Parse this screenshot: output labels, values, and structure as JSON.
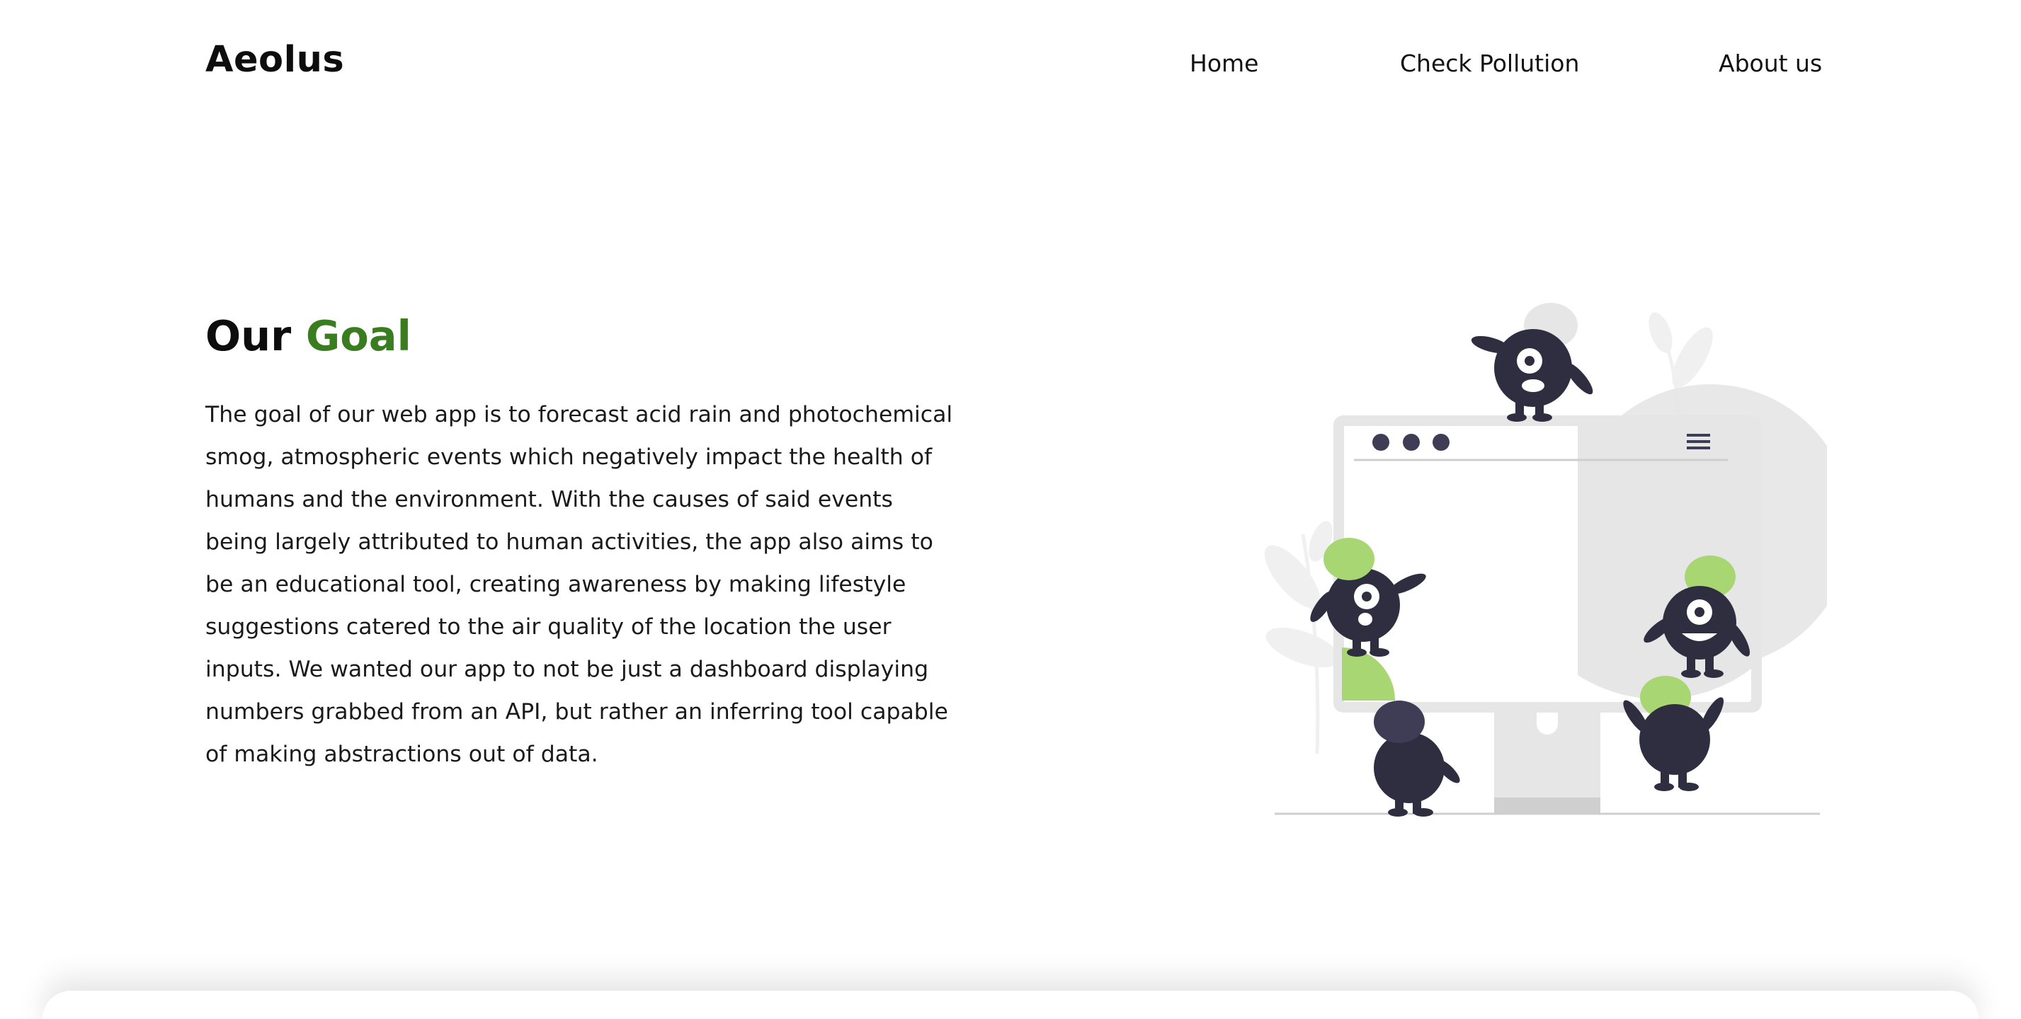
{
  "brand": {
    "name": "Aeolus"
  },
  "nav": {
    "items": [
      {
        "label": "Home"
      },
      {
        "label": "Check Pollution"
      },
      {
        "label": "About us"
      }
    ]
  },
  "goal": {
    "heading_prefix": "Our",
    "heading_accent": "Goal",
    "body": "The goal of our web app is to forecast acid rain and photochemical smog, atmospheric events which negatively impact the health of humans and the environment. With the causes of said events being largely attributed to human activities, the app also aims to be an educational tool, creating awareness by making lifestyle suggestions catered to the air quality of the location the user inputs. We wanted our app to not be just a dashboard displaying numbers grabbed from an API, but rather an inferring tool capable of making abstractions out of data."
  },
  "colors": {
    "accent_green": "#3a7d1f",
    "illustration_green": "#a8d672",
    "illustration_dark": "#2f2e41",
    "illustration_gray": "#e6e6e6"
  },
  "illustration": {
    "icon": "monsters-computer-illustration"
  }
}
